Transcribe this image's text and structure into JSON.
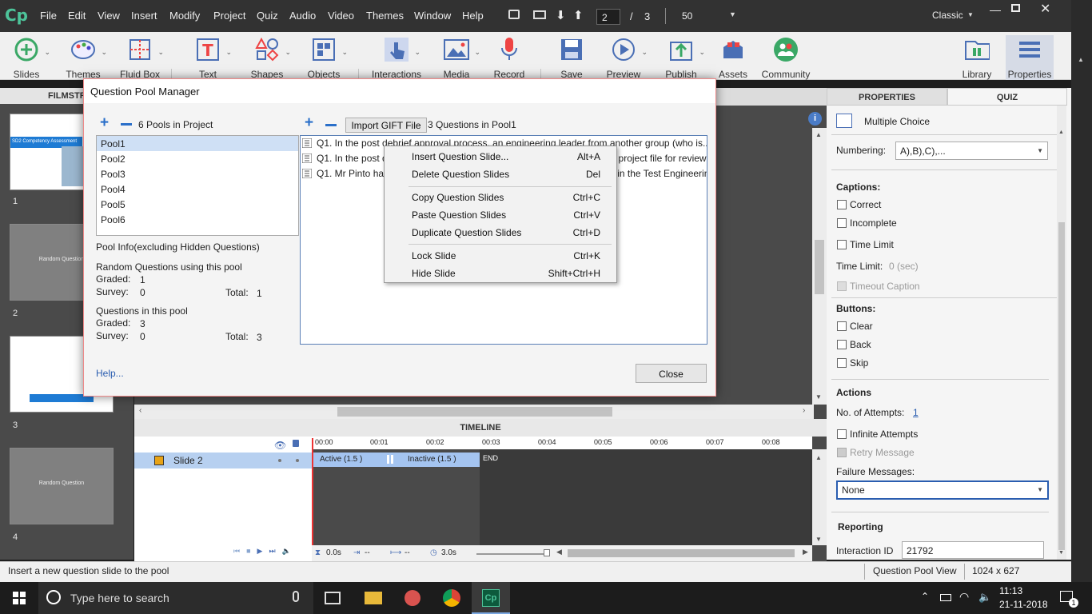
{
  "menubar": {
    "logo": "Cp",
    "items": [
      "File",
      "Edit",
      "View",
      "Insert",
      "Modify",
      "Project",
      "Quiz",
      "Audio",
      "Video",
      "Themes",
      "Window",
      "Help"
    ],
    "slide_current": "2",
    "slide_separator": "/",
    "slide_total": "3",
    "zoom": "50",
    "workspace": "Classic"
  },
  "toolbar": {
    "slides": "Slides",
    "themes": "Themes",
    "fluid_box": "Fluid Box",
    "text": "Text",
    "shapes": "Shapes",
    "objects": "Objects",
    "interactions": "Interactions",
    "media": "Media",
    "record": "Record",
    "save": "Save",
    "preview": "Preview",
    "publish": "Publish",
    "assets": "Assets",
    "community": "Community",
    "library": "Library",
    "properties": "Properties"
  },
  "filmstrip": {
    "header": "FILMSTRIP",
    "thumb1_title": "SD2 Competency Assessment",
    "thumb2_title": "Random Question",
    "thumb4_title": "Random Question",
    "numbers": [
      "1",
      "2",
      "3",
      "4"
    ]
  },
  "timeline": {
    "header": "TIMELINE",
    "slide_label": "Slide 2",
    "ticks": [
      "00:00",
      "00:01",
      "00:02",
      "00:03",
      "00:04",
      "00:05",
      "00:06",
      "00:07",
      "00:08"
    ],
    "active": "Active (1.5 )",
    "inactive": "Inactive (1.5 )",
    "end": "END",
    "t0": "0.0s",
    "t1": "--",
    "t2": "--",
    "t3": "3.0s"
  },
  "properties": {
    "tab_properties": "PROPERTIES",
    "tab_quiz": "QUIZ",
    "type": "Multiple Choice",
    "numbering_label": "Numbering:",
    "numbering_value": "A),B),C),...",
    "captions": "Captions:",
    "correct": "Correct",
    "incomplete": "Incomplete",
    "time_limit": "Time Limit",
    "time_limit_label": "Time Limit:",
    "time_limit_value": "0 (sec)",
    "timeout_caption": "Timeout Caption",
    "buttons": "Buttons:",
    "clear": "Clear",
    "back": "Back",
    "skip": "Skip",
    "actions": "Actions",
    "attempts_label": "No. of Attempts:",
    "attempts_value": "1",
    "infinite": "Infinite Attempts",
    "retry": "Retry Message",
    "failure_label": "Failure Messages:",
    "failure_value": "None",
    "reporting": "Reporting",
    "interaction_label": "Interaction ID",
    "interaction_value": "21792"
  },
  "status": {
    "hint": "Insert a new question slide to the pool",
    "view": "Question Pool View",
    "size": "1024 x 627"
  },
  "dialog": {
    "title": "Question Pool Manager",
    "pools_count": "6 Pools in Project",
    "pools": [
      "Pool1",
      "Pool2",
      "Pool3",
      "Pool4",
      "Pool5",
      "Pool6"
    ],
    "import_btn": "Import GIFT File",
    "questions_count": "3 Questions in Pool1",
    "questions": [
      "Q1. In the post debrief approval process, an engineering leader from another group (who is...",
      "Q1.  In the post debrief approval process, the SD2 team sends the final project file for review and s...",
      "Q1. Mr Pinto has recently been appointed as a reviewer for the project in the Test Engineering divisi..."
    ],
    "pool_info": "Pool Info(excluding Hidden Questions)",
    "random_using": "Random Questions using this pool",
    "graded": "Graded:",
    "survey": "Survey:",
    "total": "Total:",
    "r_graded": "1",
    "r_survey": "0",
    "r_total": "1",
    "questions_in_pool": "Questions in this pool",
    "q_graded": "3",
    "q_survey": "0",
    "q_total": "3",
    "help": "Help...",
    "close": "Close"
  },
  "context_menu": [
    {
      "label": "Insert Question Slide...",
      "key": "Alt+A"
    },
    {
      "label": "Delete Question Slides",
      "key": "Del"
    },
    {
      "label": "Copy Question Slides",
      "key": "Ctrl+C"
    },
    {
      "label": "Paste Question Slides",
      "key": "Ctrl+V"
    },
    {
      "label": "Duplicate Question Slides",
      "key": "Ctrl+D"
    },
    {
      "label": "Lock Slide",
      "key": "Ctrl+K"
    },
    {
      "label": "Hide Slide",
      "key": "Shift+Ctrl+H"
    }
  ],
  "taskbar": {
    "search_placeholder": "Type here to search",
    "time": "11:13",
    "date": "21-11-2018",
    "notif_count": "1"
  }
}
